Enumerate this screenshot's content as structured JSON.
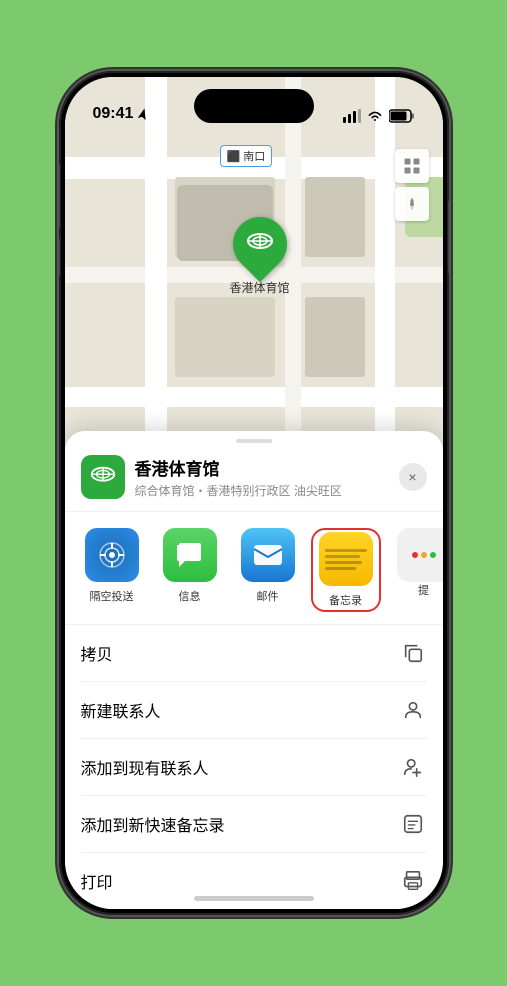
{
  "statusBar": {
    "time": "09:41",
    "locationIcon": "▶"
  },
  "mapLabel": {
    "text": "南口"
  },
  "mapControls": {
    "mapTypeIcon": "⊞",
    "locationIcon": "➤"
  },
  "pin": {
    "label": "香港体育馆"
  },
  "venueHeader": {
    "name": "香港体育馆",
    "description": "综合体育馆・香港特别行政区 油尖旺区",
    "closeLabel": "×"
  },
  "apps": [
    {
      "label": "隔空投送",
      "type": "airdrop"
    },
    {
      "label": "信息",
      "type": "messages"
    },
    {
      "label": "邮件",
      "type": "mail"
    },
    {
      "label": "备忘录",
      "type": "notes"
    },
    {
      "label": "提",
      "type": "more"
    }
  ],
  "actions": [
    {
      "label": "拷贝",
      "icon": "copy"
    },
    {
      "label": "新建联系人",
      "icon": "person"
    },
    {
      "label": "添加到现有联系人",
      "icon": "person-add"
    },
    {
      "label": "添加到新快速备忘录",
      "icon": "memo"
    },
    {
      "label": "打印",
      "icon": "print"
    }
  ]
}
